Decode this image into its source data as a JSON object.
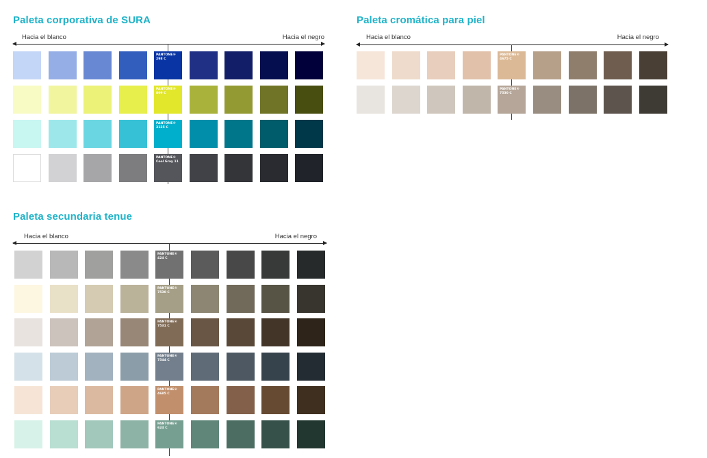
{
  "palettes": [
    {
      "id": "sura",
      "title": "Paleta corporativa de SURA",
      "left_label": "Hacia el blanco",
      "right_label": "Hacia el negro",
      "rows": [
        {
          "pantone": "PANTONE® 298 C",
          "colors": [
            "#c4d6f7",
            "#95aee6",
            "#6888d3",
            "#325ebe",
            "#0834a4",
            "#1f3085",
            "#121e67",
            "#050e4f",
            "#02003a"
          ]
        },
        {
          "pantone": "PANTONE® 809 C",
          "colors": [
            "#f8fbc4",
            "#f1f59e",
            "#ecf277",
            "#e7ef4d",
            "#e2e72c",
            "#a9b23a",
            "#949a33",
            "#707426",
            "#484d10"
          ]
        },
        {
          "pantone": "PANTONE® 3125 C",
          "colors": [
            "#c8f6f1",
            "#9de7ea",
            "#6ad6e2",
            "#36c1d6",
            "#00afcc",
            "#008eab",
            "#00768a",
            "#005c6a",
            "#00384a"
          ]
        },
        {
          "pantone": "PANTONE® Cool Gray 11",
          "colors": [
            "#ffffff",
            "#d2d2d4",
            "#a6a6a9",
            "#7d7d80",
            "#55565c",
            "#404247",
            "#333539",
            "#292b30",
            "#20242a"
          ]
        }
      ]
    },
    {
      "id": "piel",
      "title": "Paleta cromática para piel",
      "left_label": "Hacia el blanco",
      "right_label": "Hacia el negro",
      "rows": [
        {
          "pantone": "PANTONE® 4675 C",
          "colors": [
            "#f6e5d9",
            "#efdbcb",
            "#e8cebd",
            "#e1c1aa",
            "#dbb996",
            "#b7a08a",
            "#907e6d",
            "#6f5d4f",
            "#4a3f35"
          ]
        },
        {
          "pantone": "PANTONE® 7530 C",
          "colors": [
            "#e8e4df",
            "#dcd6cf",
            "#cfc7bd",
            "#c1b6aa",
            "#b5a699",
            "#998d81",
            "#7c7267",
            "#5d544e",
            "#3e3a34"
          ]
        }
      ]
    },
    {
      "id": "tenue",
      "title": "Paleta secundaria tenue",
      "left_label": "Hacia el blanco",
      "right_label": "Hacia el negro",
      "rows": [
        {
          "pantone": "PANTONE® 424 C",
          "colors": [
            "#d2d2d2",
            "#b8b8b8",
            "#a0a09f",
            "#898a89",
            "#707170",
            "#5a5b5a",
            "#474847",
            "#383a3a",
            "#262a2b"
          ]
        },
        {
          "pantone": "PANTONE® 7530 C",
          "colors": [
            "#fdf6e1",
            "#e9e0c8",
            "#d4cbb2",
            "#bbb29a",
            "#a59f87",
            "#8d8672",
            "#71695a",
            "#575345",
            "#37352d"
          ]
        },
        {
          "pantone": "PANTONE® 7531 C",
          "colors": [
            "#e8e3df",
            "#cdc3bd",
            "#b1a497",
            "#988676",
            "#806b56",
            "#6a5645",
            "#594737",
            "#433629",
            "#2e2419"
          ]
        },
        {
          "pantone": "PANTONE® 7544 C",
          "colors": [
            "#d5e1e8",
            "#bccbd6",
            "#a3b2bf",
            "#8b9da9",
            "#737f8c",
            "#5f6c77",
            "#4d5862",
            "#37434c",
            "#232c32"
          ]
        },
        {
          "pantone": "PANTONE® 4685 C",
          "colors": [
            "#f6e5d6",
            "#e8cdb9",
            "#dbb9a0",
            "#cfa588",
            "#c18f6c",
            "#a47a5d",
            "#83604a",
            "#664a32",
            "#3f2f1f"
          ]
        },
        {
          "pantone": "PANTONE® 624 C",
          "colors": [
            "#d7f2e8",
            "#b9ded2",
            "#a2c8bc",
            "#8db3a6",
            "#769f91",
            "#5f8678",
            "#4c6e62",
            "#35514a",
            "#213730"
          ]
        }
      ]
    }
  ]
}
